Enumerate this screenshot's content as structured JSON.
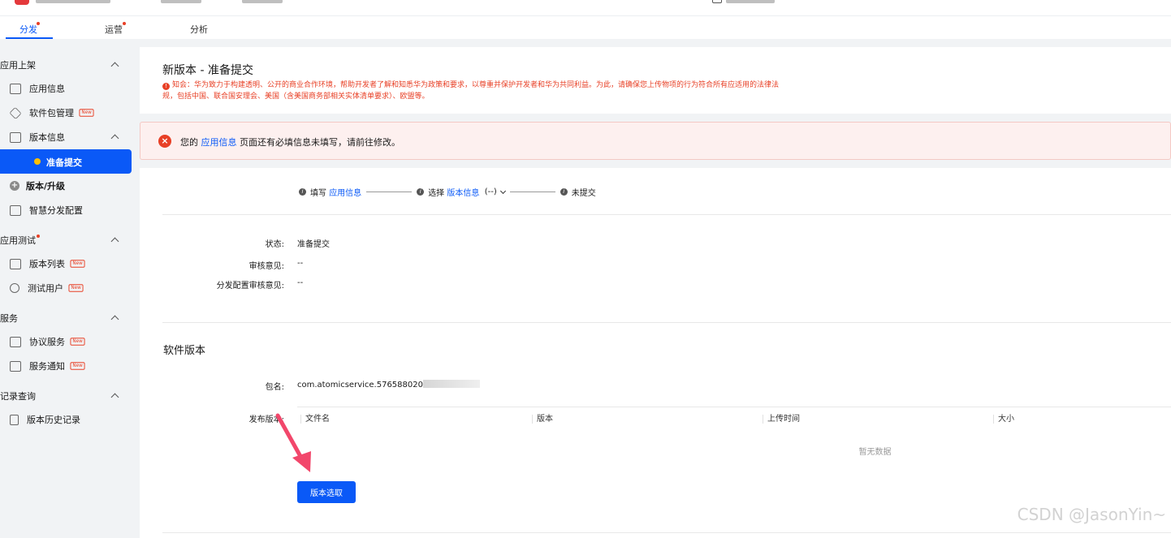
{
  "tabs": [
    {
      "label": "分发",
      "dot": true,
      "active": true
    },
    {
      "label": "运营",
      "dot": true,
      "active": false
    },
    {
      "label": "分析",
      "dot": false,
      "active": false
    }
  ],
  "sidebar": {
    "groups": [
      {
        "label": "应用上架"
      },
      {
        "label": "应用测试",
        "dot": true
      },
      {
        "label": "服务"
      },
      {
        "label": "记录查询"
      }
    ],
    "items": {
      "app_info": "应用信息",
      "package_mgmt": "软件包管理",
      "version_info": "版本信息",
      "prepare_submit": "准备提交",
      "version_upgrade": "版本/升级",
      "smart_dist": "智慧分发配置",
      "version_list": "版本列表",
      "test_users": "测试用户",
      "agreement_service": "协议服务",
      "service_notice": "服务通知",
      "version_history": "版本历史记录"
    },
    "new_badge": "New"
  },
  "header": {
    "title": "新版本 - 准备提交",
    "notice_line1": "知会：华为致力于构建透明、公开的商业合作环境，帮助开发者了解和知悉华为政策和要求，以尊重并保护开发者和华为共同利益。为此，请确保您上传物项的行为符合所有应适用的法律法",
    "notice_line2": "规，包括中国、联合国安理会、美国（含美国商务部相关实体清单要求）、欧盟等。"
  },
  "alert": {
    "prefix": "您的",
    "link": "应用信息",
    "suffix": "页面还有必填信息未填写，请前往修改。"
  },
  "steps": {
    "s1_prefix": "填写",
    "s1_link": "应用信息",
    "s2_prefix": "选择",
    "s2_link": "版本信息",
    "s2_value": "(--)",
    "s3": "未提交"
  },
  "status": {
    "status_label": "状态:",
    "status_value": "准备提交",
    "review_label": "审核意见:",
    "review_value": "--",
    "dist_review_label": "分发配置审核意见:",
    "dist_review_value": "--"
  },
  "software": {
    "section_title": "软件版本",
    "package_label": "包名:",
    "package_value": "com.atomicservice.576588020",
    "release_label": "发布版本:",
    "columns": [
      "文件名",
      "版本",
      "上传时间",
      "大小"
    ],
    "empty_text": "暂无数据",
    "select_button": "版本选取"
  },
  "watermark": "CSDN @JasonYin~",
  "colors": {
    "accent": "#0a59f7",
    "danger": "#e84026",
    "active_dot": "#ffbf00",
    "arrow": "#f2476b"
  }
}
